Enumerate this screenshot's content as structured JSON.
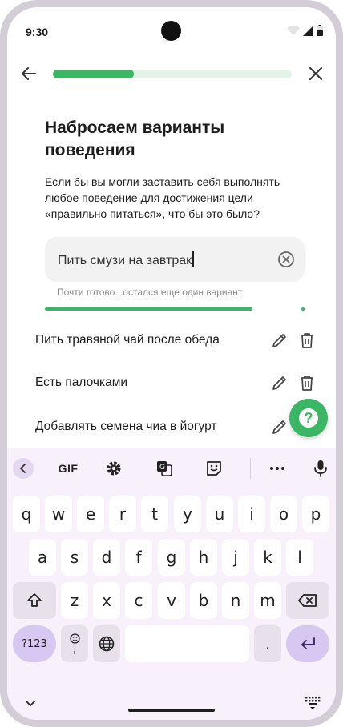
{
  "status": {
    "time": "9:30"
  },
  "header": {
    "progress_fraction": 0.34
  },
  "content": {
    "title": "Набросаем варианты поведения",
    "question": "Если бы вы могли заставить себя выполнять любое поведение для достижения цели «правильно питаться», что бы это было?",
    "input_value": "Пить смузи на завтрак",
    "hint": "Почти готово...остался еще один вариант",
    "progress_fraction": 0.8
  },
  "items": [
    {
      "label": "Пить травяной чай после обеда"
    },
    {
      "label": "Есть палочками"
    },
    {
      "label": "Добавлять семена чиа в йогурт"
    }
  ],
  "help": {
    "label": "?"
  },
  "keyboard": {
    "gif_label": "GIF",
    "row1": [
      "q",
      "w",
      "e",
      "r",
      "t",
      "y",
      "u",
      "i",
      "o",
      "p"
    ],
    "row2": [
      "a",
      "s",
      "d",
      "f",
      "g",
      "h",
      "j",
      "k",
      "l"
    ],
    "row3": [
      "z",
      "x",
      "c",
      "v",
      "b",
      "n",
      "m"
    ],
    "symbols_label": "?123",
    "emoji_comma_label": ",",
    "period_label": "."
  },
  "colors": {
    "accent": "#3bb665",
    "keyboard_bg": "#f8f0fa",
    "enter_key": "#d7c8f1"
  }
}
